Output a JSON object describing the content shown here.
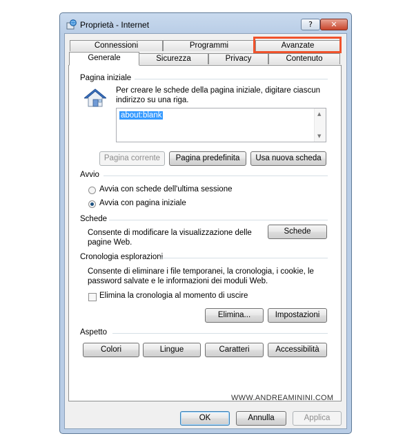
{
  "window": {
    "title": "Proprietà - Internet",
    "help_label": "?",
    "close_label": "✕"
  },
  "tabs": {
    "row1": [
      "Connessioni",
      "Programmi",
      "Avanzate"
    ],
    "row2": [
      "Generale",
      "Sicurezza",
      "Privacy",
      "Contenuto"
    ],
    "active": "Generale",
    "highlighted": "Avanzate",
    "highlight_color": "#f0522b"
  },
  "homepage": {
    "group_label": "Pagina iniziale",
    "description": "Per creare le schede della pagina iniziale, digitare ciascun indirizzo su una riga.",
    "description_line1": "Per creare le schede della pagina iniziale, digitare ciascun",
    "description_line2": "indirizzo su una riga.",
    "value": "about:blank",
    "buttons": {
      "current": "Pagina corrente",
      "default": "Pagina predefinita",
      "new_tab": "Usa nuova scheda"
    }
  },
  "startup": {
    "group_label": "Avvio",
    "option_last_session": "Avvia con schede dell'ultima sessione",
    "option_home_page": "Avvia con pagina iniziale",
    "selected": "option_home_page"
  },
  "tabs_section": {
    "group_label": "Schede",
    "description_line1": "Consente di modificare la visualizzazione delle",
    "description_line2": "pagine Web.",
    "button": "Schede"
  },
  "history": {
    "group_label": "Cronologia esplorazioni",
    "description_line1": "Consente di eliminare i file temporanei, la cronologia, i cookie, le",
    "description_line2": "password salvate e le informazioni dei moduli Web.",
    "checkbox_label": "Elimina la cronologia al momento di uscire",
    "checkbox_checked": false,
    "delete_button": "Elimina...",
    "settings_button": "Impostazioni"
  },
  "appearance": {
    "group_label": "Aspetto",
    "buttons": [
      "Colori",
      "Lingue",
      "Caratteri",
      "Accessibilità"
    ]
  },
  "watermark": "WWW.ANDREAMININI.COM",
  "footer": {
    "ok": "OK",
    "cancel": "Annulla",
    "apply": "Applica"
  }
}
